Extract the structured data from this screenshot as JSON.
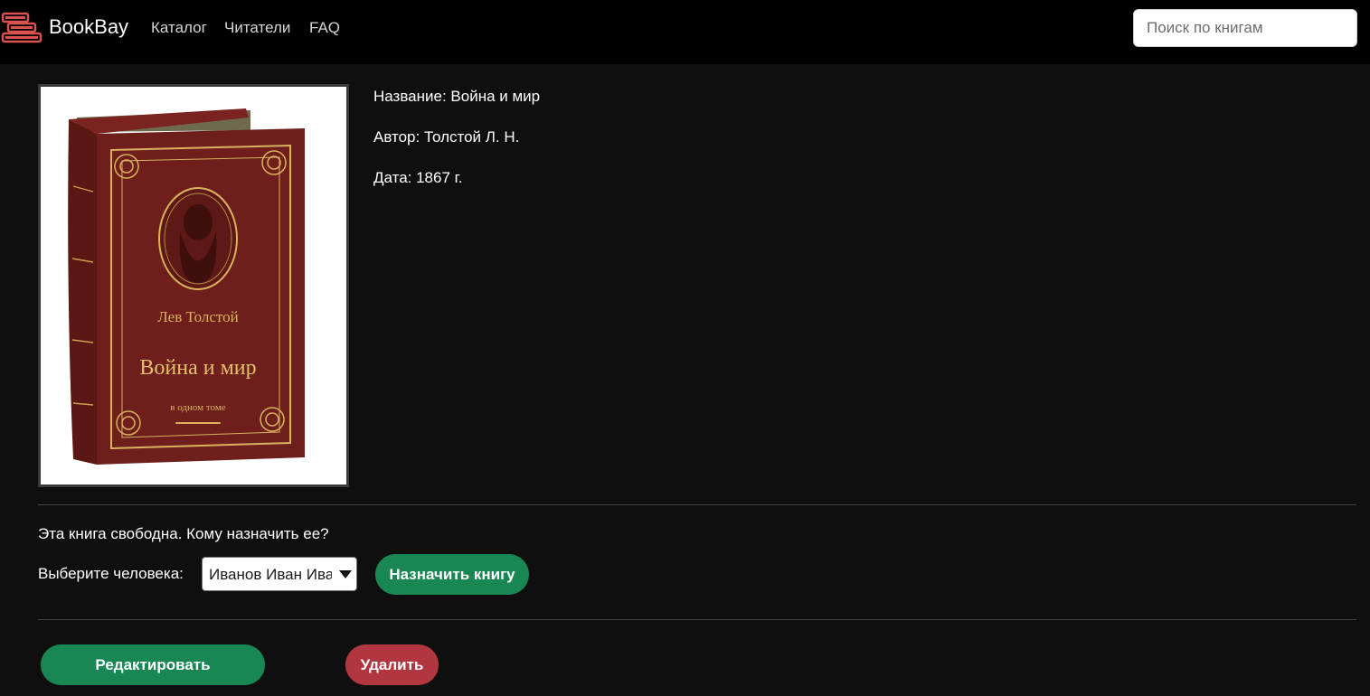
{
  "brand": {
    "name": "BookBay",
    "icon": "books-stack-icon"
  },
  "nav": {
    "links": [
      "Каталог",
      "Читатели",
      "FAQ"
    ]
  },
  "search": {
    "placeholder": "Поиск по книгам",
    "value": ""
  },
  "book": {
    "cover": {
      "author_text": "Лев Толстой",
      "title_text": "Война и мир",
      "subtitle_text": "в одном томе"
    },
    "title_line": "Название: Война и мир",
    "author_line": "Автор: Толстой Л. Н.",
    "date_line": "Дата: 1867 г."
  },
  "assign": {
    "status": "Эта книга свободна. Кому назначить ее?",
    "select_label": "Выберите человека:",
    "selected_person": "Иванов Иван Иванович",
    "button_label": "Назначить книгу"
  },
  "actions": {
    "edit_label": "Редактировать",
    "delete_label": "Удалить"
  },
  "colors": {
    "background": "#0f0f0f",
    "navbar": "#000000",
    "success": "#198754",
    "danger": "#b2363f",
    "brand_icon": "#d9534f",
    "book_leather": "#6e1f1c",
    "gold": "#d8b25c"
  }
}
